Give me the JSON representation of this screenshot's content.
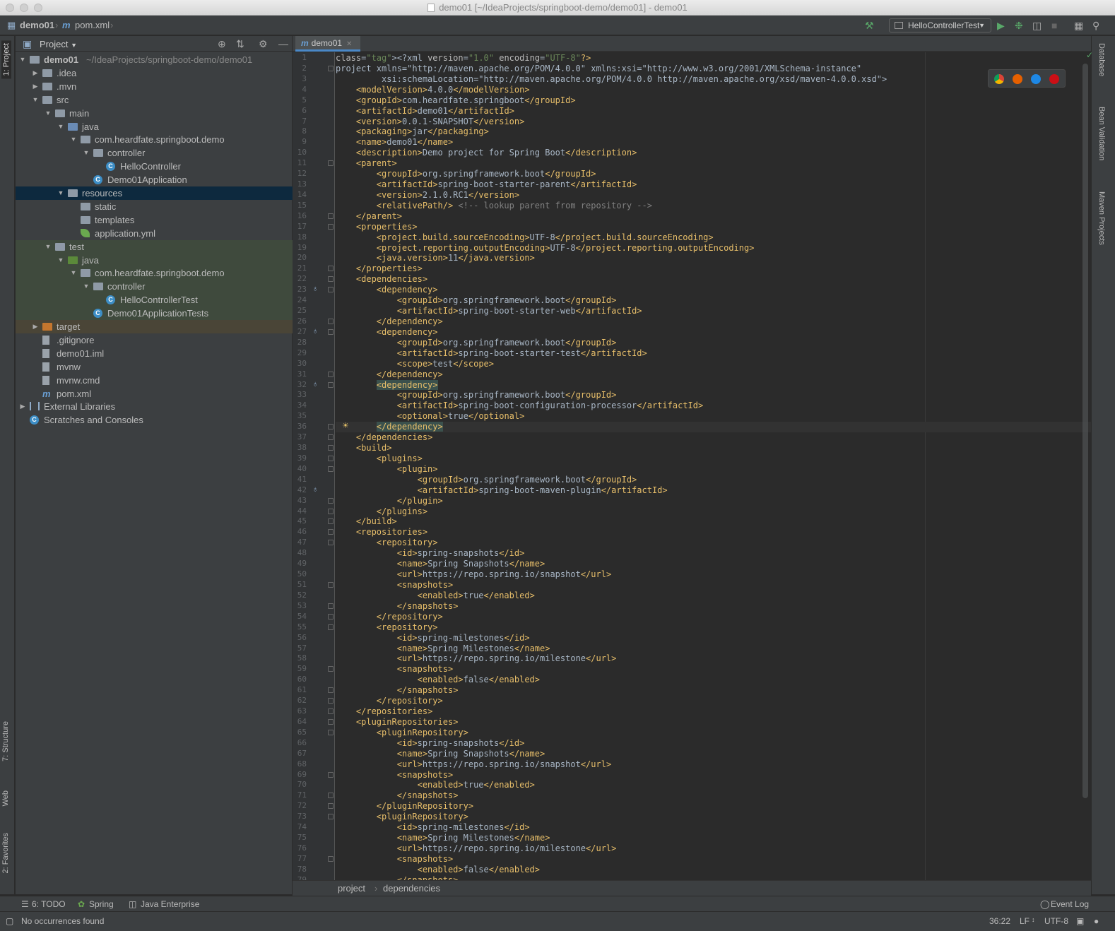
{
  "window": {
    "title": "demo01 [~/IdeaProjects/springboot-demo/demo01] - demo01"
  },
  "navbar": {
    "crumb_project": "demo01",
    "crumb_file": "pom.xml",
    "run_config": "HelloControllerTest",
    "icons": [
      "hammer-icon",
      "run-icon",
      "debug-icon",
      "coverage-icon",
      "stop-icon",
      "project-structure-icon",
      "search-icon"
    ]
  },
  "left_strip": {
    "project_tab": "1: Project",
    "structure_tab": "7: Structure",
    "web_tab": "Web",
    "favorites_tab": "2: Favorites"
  },
  "project_panel": {
    "title": "Project",
    "tree": [
      {
        "label": "demo01",
        "extra": "~/IdeaProjects/springboot-demo/demo01"
      },
      {
        "label": ".idea"
      },
      {
        "label": ".mvn"
      },
      {
        "label": "src"
      },
      {
        "label": "main"
      },
      {
        "label": "java"
      },
      {
        "label": "com.heardfate.springboot.demo"
      },
      {
        "label": "controller"
      },
      {
        "label": "HelloController"
      },
      {
        "label": "Demo01Application"
      },
      {
        "label": "resources"
      },
      {
        "label": "static"
      },
      {
        "label": "templates"
      },
      {
        "label": "application.yml"
      },
      {
        "label": "test"
      },
      {
        "label": "java"
      },
      {
        "label": "com.heardfate.springboot.demo"
      },
      {
        "label": "controller"
      },
      {
        "label": "HelloControllerTest"
      },
      {
        "label": "Demo01ApplicationTests"
      },
      {
        "label": "target"
      },
      {
        "label": ".gitignore"
      },
      {
        "label": "demo01.iml"
      },
      {
        "label": "mvnw"
      },
      {
        "label": "mvnw.cmd"
      },
      {
        "label": "pom.xml"
      },
      {
        "label": "External Libraries"
      },
      {
        "label": "Scratches and Consoles"
      }
    ]
  },
  "editor": {
    "tab_label": "demo01",
    "cursor_line": 36,
    "line_numbers": [
      "1",
      "2",
      "3",
      "4",
      "5",
      "6",
      "7",
      "8",
      "9",
      "10",
      "11",
      "12",
      "13",
      "14",
      "15",
      "16",
      "17",
      "18",
      "19",
      "20",
      "21",
      "22",
      "23",
      "24",
      "25",
      "26",
      "27",
      "28",
      "29",
      "30",
      "31",
      "32",
      "33",
      "34",
      "35",
      "36",
      "37",
      "38",
      "39",
      "40",
      "41",
      "42",
      "43",
      "44",
      "45",
      "46",
      "47",
      "48",
      "49",
      "50",
      "51",
      "52",
      "53",
      "54",
      "55",
      "56",
      "57",
      "58",
      "59",
      "60",
      "61",
      "62",
      "63",
      "64",
      "65",
      "66",
      "67",
      "68",
      "69",
      "70",
      "71",
      "72",
      "73",
      "74",
      "75",
      "76",
      "77",
      "78",
      "79"
    ],
    "lines": [
      "<?xml version=\"1.0\" encoding=\"UTF-8\"?>",
      "<project xmlns=\"http://maven.apache.org/POM/4.0.0\" xmlns:xsi=\"http://www.w3.org/2001/XMLSchema-instance\"",
      "         xsi:schemaLocation=\"http://maven.apache.org/POM/4.0.0 http://maven.apache.org/xsd/maven-4.0.0.xsd\">",
      "    <modelVersion>4.0.0</modelVersion>",
      "    <groupId>com.heardfate.springboot</groupId>",
      "    <artifactId>demo01</artifactId>",
      "    <version>0.0.1-SNAPSHOT</version>",
      "    <packaging>jar</packaging>",
      "    <name>demo01</name>",
      "    <description>Demo project for Spring Boot</description>",
      "    <parent>",
      "        <groupId>org.springframework.boot</groupId>",
      "        <artifactId>spring-boot-starter-parent</artifactId>",
      "        <version>2.1.0.RC1</version>",
      "        <relativePath/> <!-- lookup parent from repository -->",
      "    </parent>",
      "    <properties>",
      "        <project.build.sourceEncoding>UTF-8</project.build.sourceEncoding>",
      "        <project.reporting.outputEncoding>UTF-8</project.reporting.outputEncoding>",
      "        <java.version>11</java.version>",
      "    </properties>",
      "    <dependencies>",
      "        <dependency>",
      "            <groupId>org.springframework.boot</groupId>",
      "            <artifactId>spring-boot-starter-web</artifactId>",
      "        </dependency>",
      "        <dependency>",
      "            <groupId>org.springframework.boot</groupId>",
      "            <artifactId>spring-boot-starter-test</artifactId>",
      "            <scope>test</scope>",
      "        </dependency>",
      "        <dependency>",
      "            <groupId>org.springframework.boot</groupId>",
      "            <artifactId>spring-boot-configuration-processor</artifactId>",
      "            <optional>true</optional>",
      "        </dependency>",
      "    </dependencies>",
      "    <build>",
      "        <plugins>",
      "            <plugin>",
      "                <groupId>org.springframework.boot</groupId>",
      "                <artifactId>spring-boot-maven-plugin</artifactId>",
      "            </plugin>",
      "        </plugins>",
      "    </build>",
      "    <repositories>",
      "        <repository>",
      "            <id>spring-snapshots</id>",
      "            <name>Spring Snapshots</name>",
      "            <url>https://repo.spring.io/snapshot</url>",
      "            <snapshots>",
      "                <enabled>true</enabled>",
      "            </snapshots>",
      "        </repository>",
      "        <repository>",
      "            <id>spring-milestones</id>",
      "            <name>Spring Milestones</name>",
      "            <url>https://repo.spring.io/milestone</url>",
      "            <snapshots>",
      "                <enabled>false</enabled>",
      "            </snapshots>",
      "        </repository>",
      "    </repositories>",
      "    <pluginRepositories>",
      "        <pluginRepository>",
      "            <id>spring-snapshots</id>",
      "            <name>Spring Snapshots</name>",
      "            <url>https://repo.spring.io/snapshot</url>",
      "            <snapshots>",
      "                <enabled>true</enabled>",
      "            </snapshots>",
      "        </pluginRepository>",
      "        <pluginRepository>",
      "            <id>spring-milestones</id>",
      "            <name>Spring Milestones</name>",
      "            <url>https://repo.spring.io/milestone</url>",
      "            <snapshots>",
      "                <enabled>false</enabled>",
      "            </snapshots>"
    ],
    "breadcrumbs": [
      "project",
      "dependencies"
    ]
  },
  "right_strip": {
    "database_tab": "Database",
    "bean_validation_tab": "Bean Validation",
    "maven_tab": "Maven Projects"
  },
  "bottom_tools": {
    "todo": "6: TODO",
    "spring": "Spring",
    "java_enterprise": "Java Enterprise",
    "event_log": "Event Log"
  },
  "status": {
    "message": "No occurrences found",
    "position": "36:22",
    "line_sep": "LF",
    "encoding": "UTF-8"
  }
}
